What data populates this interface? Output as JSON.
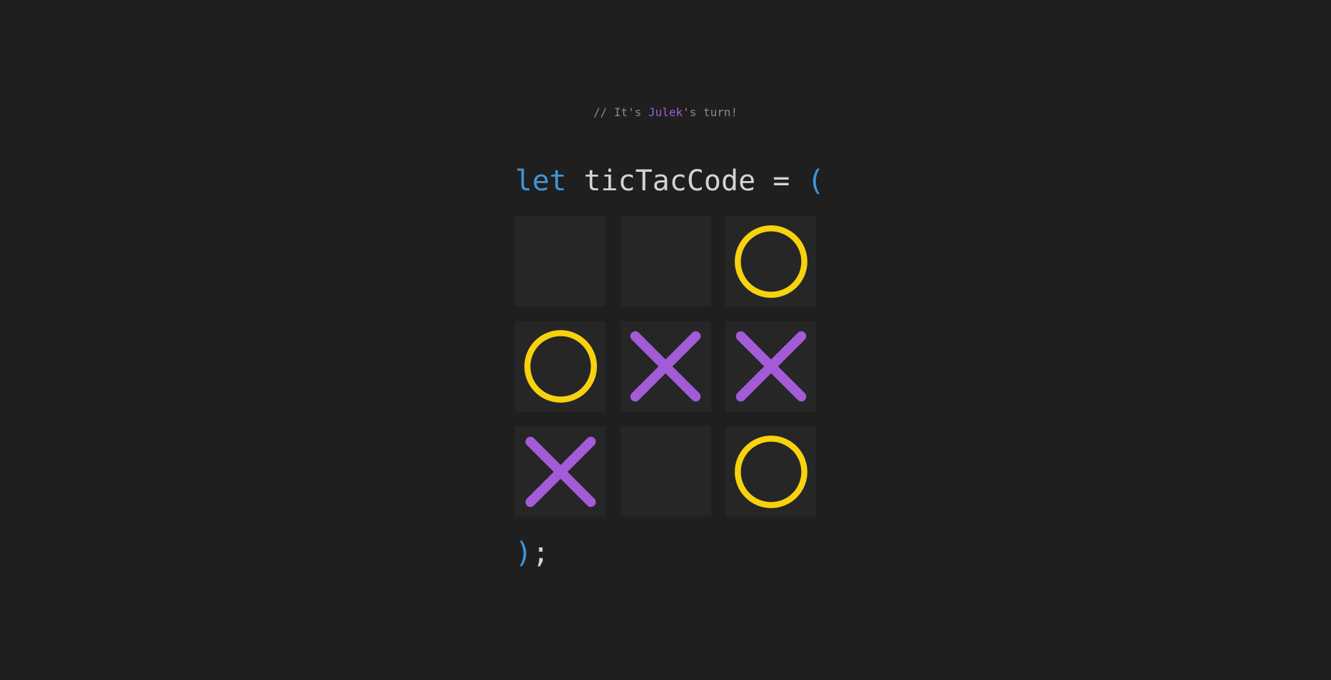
{
  "turn": {
    "prefix": "// It's ",
    "player": "Julek",
    "suffix": "'s turn!"
  },
  "code": {
    "keyword": "let",
    "name": "ticTacCode",
    "equals": "=",
    "open_paren": "(",
    "close_paren": ")",
    "semicolon": ";"
  },
  "board": {
    "cells": [
      "",
      "",
      "O",
      "O",
      "X",
      "X",
      "X",
      "",
      "O"
    ]
  },
  "colors": {
    "x": "#a35bd8",
    "o": "#f8d20f",
    "cell": "#262626",
    "background": "#1f1f1f",
    "keyword": "#3f96d6"
  }
}
